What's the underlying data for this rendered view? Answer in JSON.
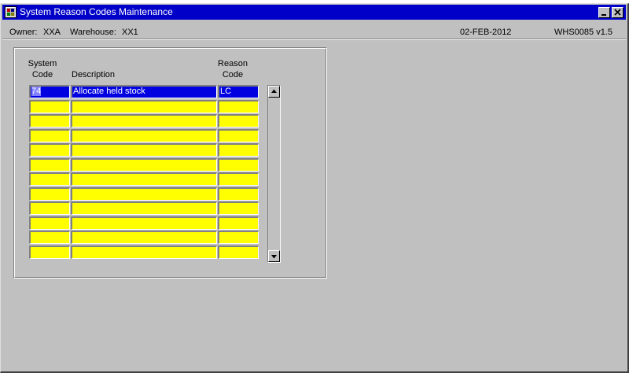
{
  "window": {
    "title": "System Reason Codes Maintenance",
    "icons": {
      "app": "app-icon",
      "minimize": "minimize-icon",
      "close": "close-icon"
    }
  },
  "header": {
    "owner_label": "Owner:",
    "owner_value": "XXA",
    "warehouse_label": "Warehouse:",
    "warehouse_value": "XX1",
    "date": "02-FEB-2012",
    "form_id": "WHS0085  v1.5"
  },
  "table": {
    "columns": {
      "system_code": [
        "System",
        "Code"
      ],
      "description": "Description",
      "reason_code": [
        "Reason",
        "Code"
      ]
    },
    "rows": [
      {
        "system_code": "74",
        "description": "Allocate held stock",
        "reason_code": "LC"
      },
      {
        "system_code": "",
        "description": "",
        "reason_code": ""
      },
      {
        "system_code": "",
        "description": "",
        "reason_code": ""
      },
      {
        "system_code": "",
        "description": "",
        "reason_code": ""
      },
      {
        "system_code": "",
        "description": "",
        "reason_code": ""
      },
      {
        "system_code": "",
        "description": "",
        "reason_code": ""
      },
      {
        "system_code": "",
        "description": "",
        "reason_code": ""
      },
      {
        "system_code": "",
        "description": "",
        "reason_code": ""
      },
      {
        "system_code": "",
        "description": "",
        "reason_code": ""
      },
      {
        "system_code": "",
        "description": "",
        "reason_code": ""
      },
      {
        "system_code": "",
        "description": "",
        "reason_code": ""
      },
      {
        "system_code": "",
        "description": "",
        "reason_code": ""
      }
    ]
  },
  "scrollbar": {
    "up_icon": "arrow-up-icon",
    "down_icon": "arrow-down-icon"
  },
  "colors": {
    "title_bar": "#0000c8",
    "field_background": "#ffff00",
    "selected_row": "#0000e0",
    "window_background": "#c0c0c0"
  }
}
